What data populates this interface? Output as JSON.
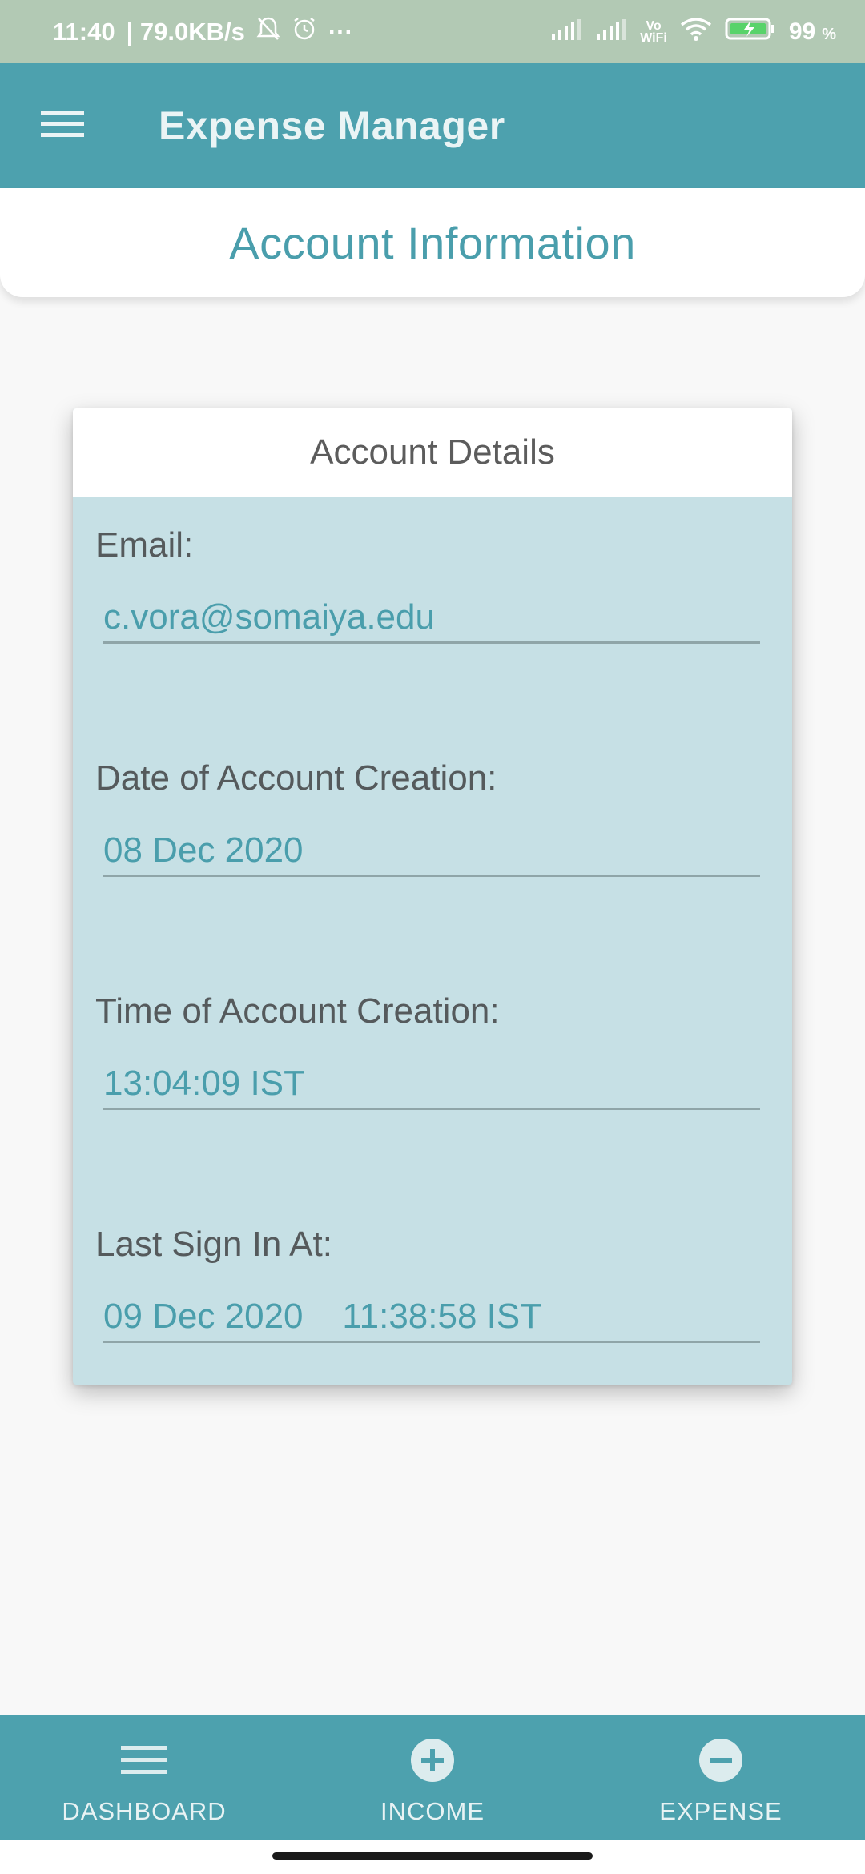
{
  "status_bar": {
    "time": "11:40",
    "net_speed": "| 79.0KB/s",
    "more": "···",
    "vowifi_top": "Vo",
    "vowifi_bottom": "WiFi",
    "battery": "99",
    "battery_unit": "%"
  },
  "app_bar": {
    "title": "Expense Manager",
    "menu_icon": "hamburger-menu-icon"
  },
  "page": {
    "title": "Account Information"
  },
  "details": {
    "header": "Account Details",
    "email_label": "Email:",
    "email_value": "c.vora@somaiya.edu",
    "creation_date_label": "Date of Account Creation:",
    "creation_date_value": "08 Dec 2020",
    "creation_time_label": "Time of Account Creation:",
    "creation_time_value": "13:04:09 IST",
    "last_sign_in_label": "Last Sign In At:",
    "last_sign_in_value": "09 Dec 2020    11:38:58 IST"
  },
  "bottom_nav": {
    "items": [
      {
        "label": "DASHBOARD",
        "icon": "list-icon"
      },
      {
        "label": "INCOME",
        "icon": "plus-circle-icon"
      },
      {
        "label": "EXPENSE",
        "icon": "minus-circle-icon"
      }
    ]
  },
  "colors": {
    "primary": "#4da1ae",
    "accent_text": "#4a9eac",
    "card_body": "#c6e0e5",
    "status_bar": "#b2c9b4"
  }
}
